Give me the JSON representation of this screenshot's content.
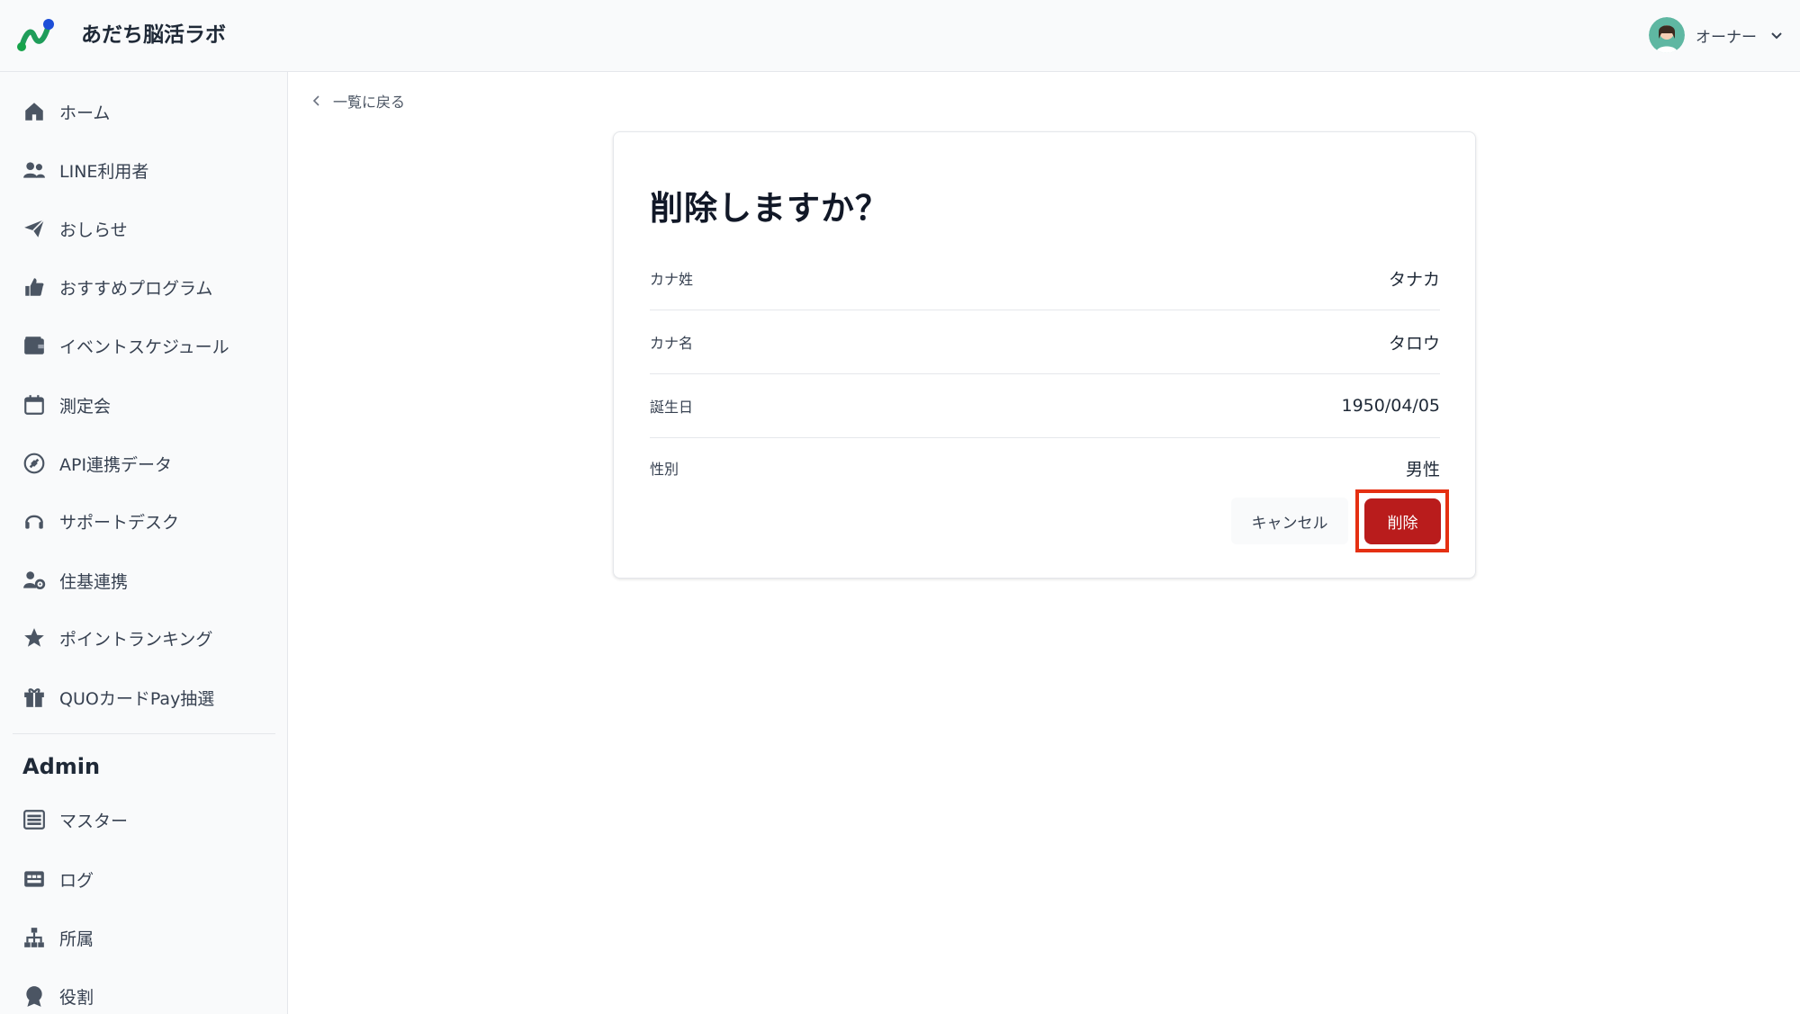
{
  "header": {
    "app_title": "あだち脳活ラボ",
    "user_name": "オーナー"
  },
  "sidebar": {
    "items": [
      {
        "label": "ホーム",
        "icon": "home-icon"
      },
      {
        "label": "LINE利用者",
        "icon": "users-icon"
      },
      {
        "label": "おしらせ",
        "icon": "paper-plane-icon"
      },
      {
        "label": "おすすめプログラム",
        "icon": "thumbs-up-icon"
      },
      {
        "label": "イベントスケジュール",
        "icon": "wallet-icon"
      },
      {
        "label": "測定会",
        "icon": "calendar-icon"
      },
      {
        "label": "API連携データ",
        "icon": "plug-circle-icon"
      },
      {
        "label": "サポートデスク",
        "icon": "headset-icon"
      },
      {
        "label": "住基連携",
        "icon": "user-gear-icon"
      },
      {
        "label": "ポイントランキング",
        "icon": "star-icon"
      },
      {
        "label": "QUOカードPay抽選",
        "icon": "gift-icon"
      }
    ],
    "admin_title": "Admin",
    "admin_items": [
      {
        "label": "マスター",
        "icon": "list-icon"
      },
      {
        "label": "ログ",
        "icon": "log-icon"
      },
      {
        "label": "所属",
        "icon": "org-chart-icon"
      },
      {
        "label": "役割",
        "icon": "badge-icon"
      }
    ]
  },
  "main": {
    "back_label": "一覧に戻る",
    "dialog": {
      "title": "削除しますか？",
      "rows": [
        {
          "label": "カナ姓",
          "value": "タナカ"
        },
        {
          "label": "カナ名",
          "value": "タロウ"
        },
        {
          "label": "誕生日",
          "value": "1950/04/05"
        },
        {
          "label": "性別",
          "value": "男性"
        }
      ],
      "cancel_label": "キャンセル",
      "delete_label": "削除"
    }
  },
  "colors": {
    "accent_red": "#b91c1c",
    "highlight": "#e53012",
    "logo_green": "#22a06b",
    "logo_blue": "#1d4ed8"
  }
}
